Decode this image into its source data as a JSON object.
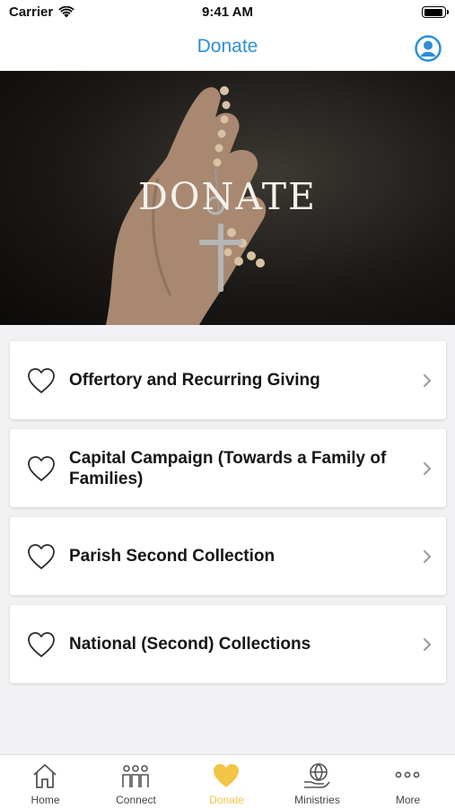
{
  "status_bar": {
    "carrier": "Carrier",
    "time": "9:41 AM"
  },
  "nav": {
    "title": "Donate"
  },
  "hero": {
    "title": "DONATE"
  },
  "donation_items": [
    {
      "label": "Offertory and Recurring Giving"
    },
    {
      "label": "Capital Campaign (Towards a Family of Families)"
    },
    {
      "label": "Parish Second Collection"
    },
    {
      "label": "National (Second) Collections"
    }
  ],
  "tabs": [
    {
      "label": "Home",
      "icon": "house-icon"
    },
    {
      "label": "Connect",
      "icon": "people-icon"
    },
    {
      "label": "Donate",
      "icon": "heart-icon",
      "active": true
    },
    {
      "label": "Ministries",
      "icon": "globe-hand-icon"
    },
    {
      "label": "More",
      "icon": "more-icon"
    }
  ],
  "colors": {
    "accent": "#2c8fd6",
    "active_tab": "#f3c445",
    "background": "#f2f2f4"
  }
}
